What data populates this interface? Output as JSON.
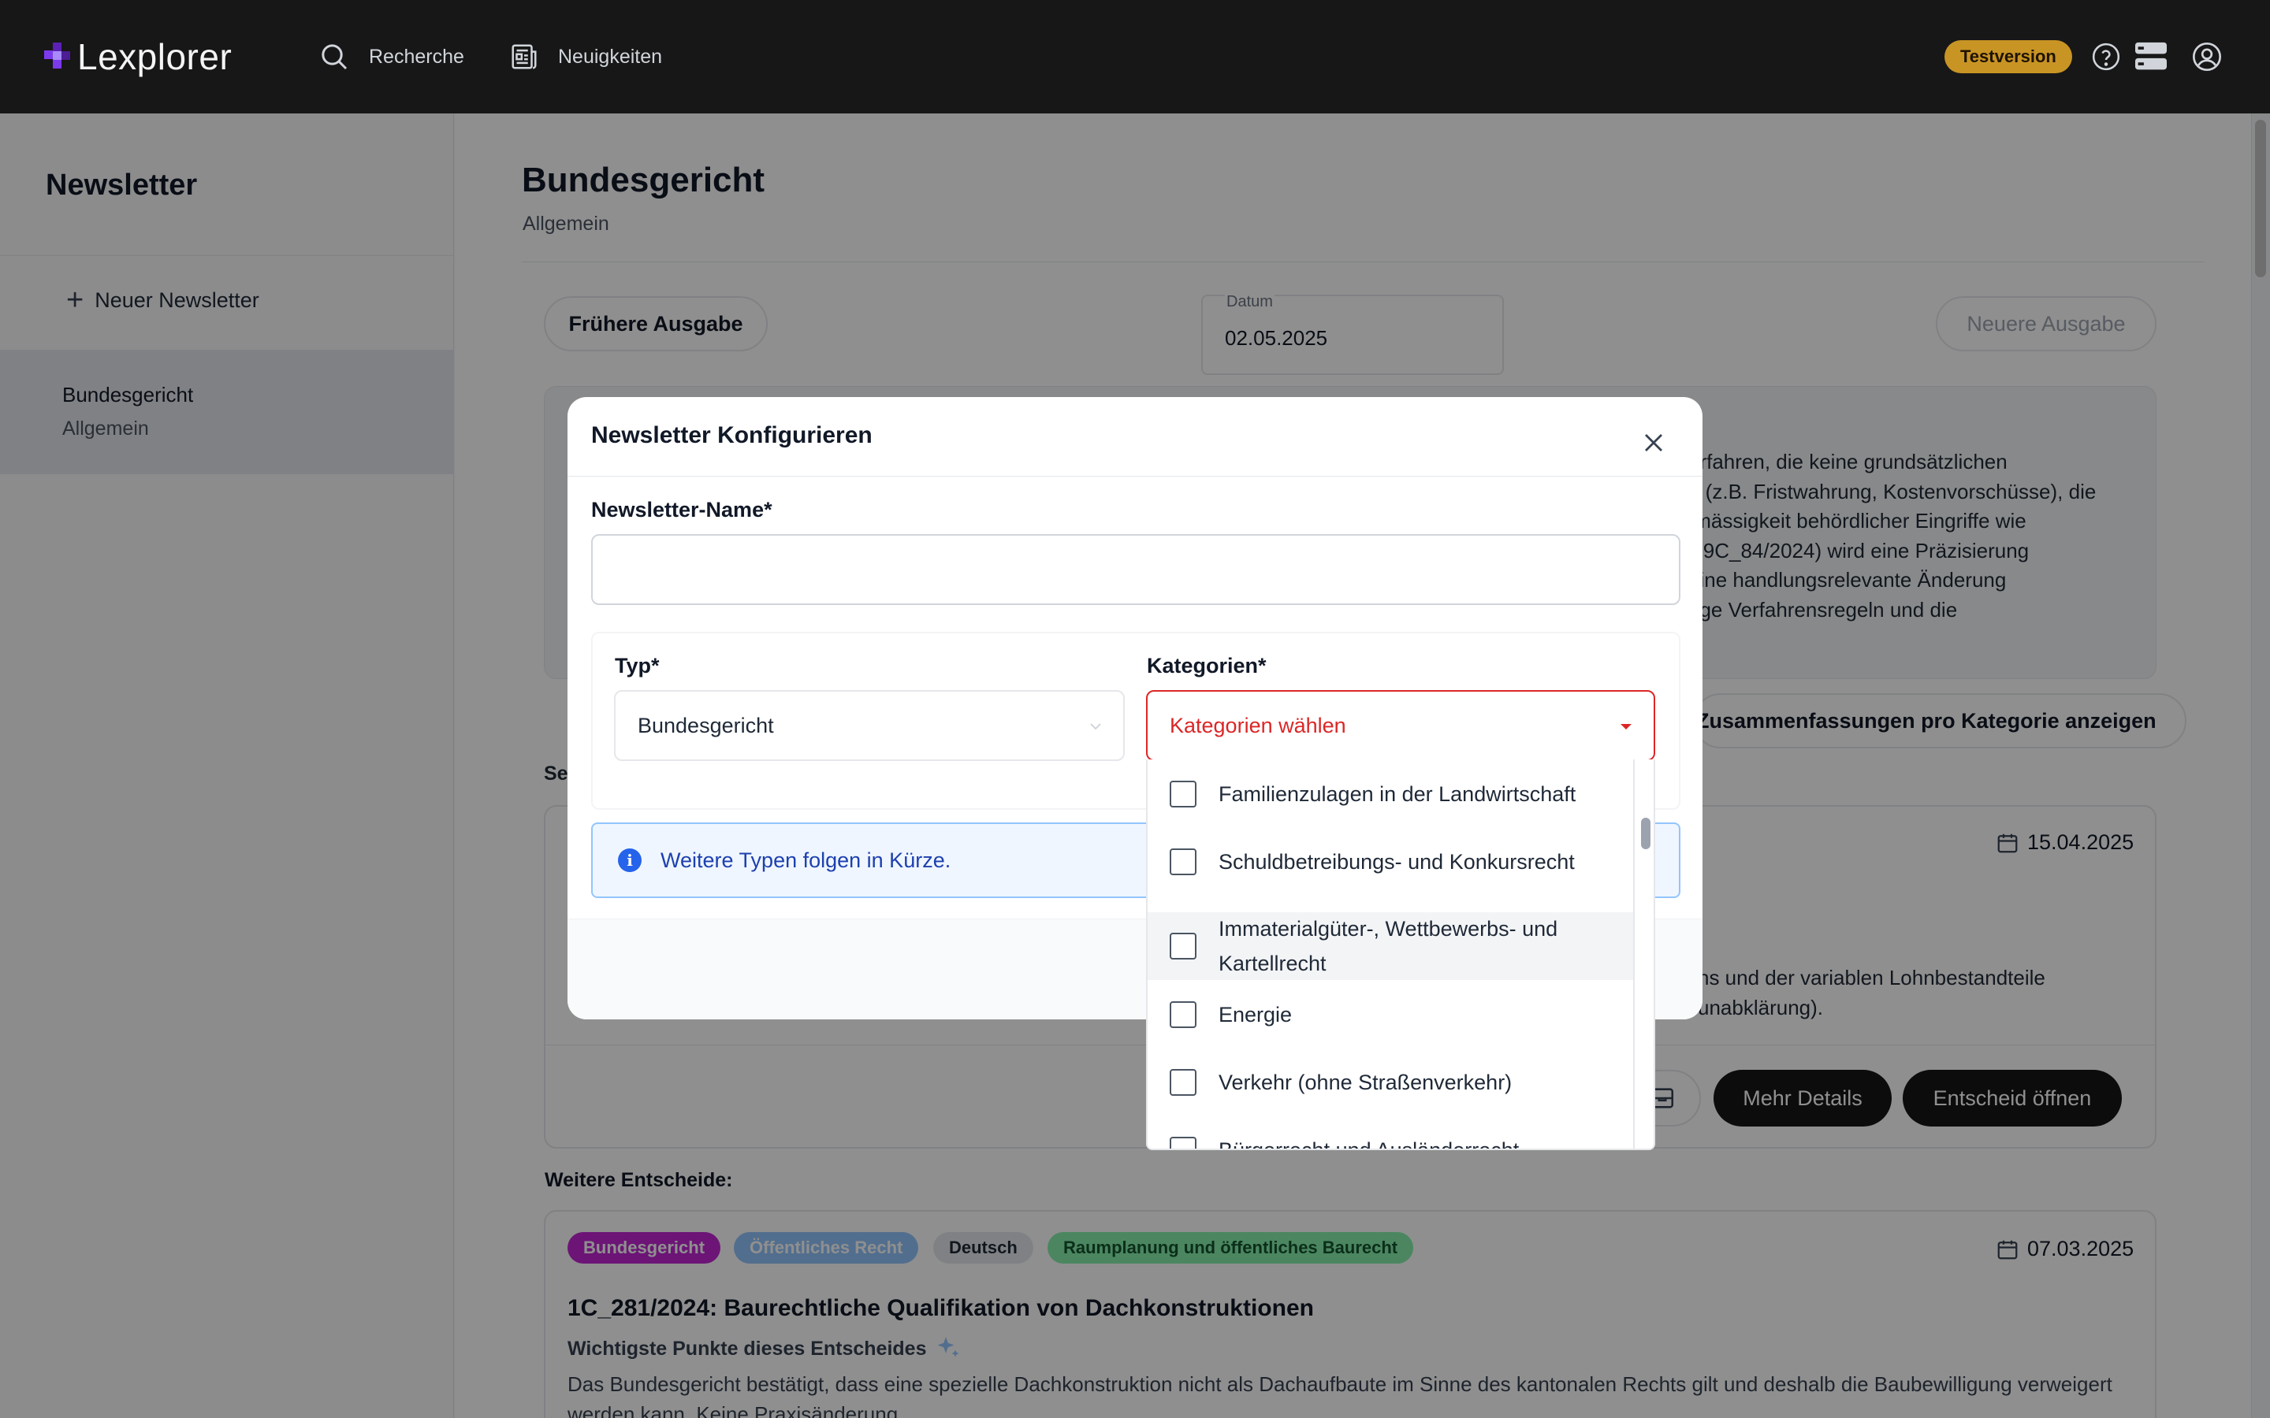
{
  "header": {
    "logo": "Lexplorer",
    "nav": [
      {
        "label": "Recherche",
        "icon": "search-icon"
      },
      {
        "label": "Neuigkeiten",
        "icon": "newspaper-icon"
      }
    ],
    "badge": "Testversion",
    "icons": [
      "help-icon",
      "layers-icon",
      "user-icon"
    ]
  },
  "sidebar": {
    "title": "Newsletter",
    "new_button": "Neuer Newsletter",
    "items": [
      {
        "title": "Bundesgericht",
        "subtitle": "Allgemein"
      }
    ]
  },
  "main": {
    "title": "Bundesgericht",
    "subtitle": "Allgemein",
    "prev_button": "Frühere Ausgabe",
    "next_button": "Neuere Ausgabe",
    "date_label": "Datum",
    "date_value": "02.05.2025",
    "summary_lines": [
      "erfahren, die keine grundsätzlichen",
      "n (z.B. Fristwahrung, Kostenvorschüsse), die",
      "tmässigkeit behördlicher Eingriffe wie",
      "il 9C_84/2024) wird eine Präzisierung",
      " eine handlungsrelevante Änderung",
      "nge Verfahrensregeln und die"
    ],
    "category_toggle": "Zusammenfassungen pro Kategorie anzeigen",
    "section_label": "Se",
    "decision1": {
      "date": "15.04.2025",
      "text_lines": [
        "ns und der variablen Lohnbestandteile",
        "unabklärung)."
      ],
      "details_button": "Mehr Details",
      "open_button": "Entscheid öffnen"
    },
    "more_label": "Weitere Entscheide:",
    "decision2": {
      "tags": [
        {
          "label": "Bundesgericht",
          "bg": "#c026d3",
          "fg": "#ffffff"
        },
        {
          "label": "Öffentliches Recht",
          "bg": "#93c5fd",
          "fg": "#ffffff"
        },
        {
          "label": "Deutsch",
          "bg": "#e5e7eb",
          "fg": "#1f2937"
        },
        {
          "label": "Raumplanung und öffentliches Baurecht",
          "bg": "#86efac",
          "fg": "#14532d"
        }
      ],
      "date": "07.03.2025",
      "title": "1C_281/2024: Baurechtliche Qualifikation von Dachkonstruktionen",
      "subtitle": "Wichtigste Punkte dieses Entscheides",
      "text": "Das Bundesgericht bestätigt, dass eine spezielle Dachkonstruktion nicht als Dachaufbaute im Sinne des kantonalen Rechts gilt und deshalb die Baubewilligung verweigert werden kann. Keine Praxisänderung."
    }
  },
  "modal": {
    "title": "Newsletter Konfigurieren",
    "name_label": "Newsletter-Name*",
    "name_value": "",
    "type_label": "Typ*",
    "type_value": "Bundesgericht",
    "categories_label": "Kategorien*",
    "categories_placeholder": "Kategorien wählen",
    "info": "Weitere Typen folgen in Kürze.",
    "category_options": [
      {
        "label": "Familienzulagen in der Landwirtschaft",
        "checked": false
      },
      {
        "label": "Schuldbetreibungs- und Konkursrecht",
        "checked": false
      },
      {
        "label": "Immaterialgüter-, Wettbewerbs- und Kartellrecht",
        "checked": false
      },
      {
        "label": "Energie",
        "checked": false
      },
      {
        "label": "Verkehr (ohne Straßenverkehr)",
        "checked": false
      },
      {
        "label": "Bürgerrecht und Ausländerrecht",
        "checked": false
      }
    ]
  },
  "colors": {
    "accent_purple": "#7c3aed",
    "badge_gold": "#c89424",
    "error_red": "#dc2626",
    "info_blue": "#2563eb"
  }
}
